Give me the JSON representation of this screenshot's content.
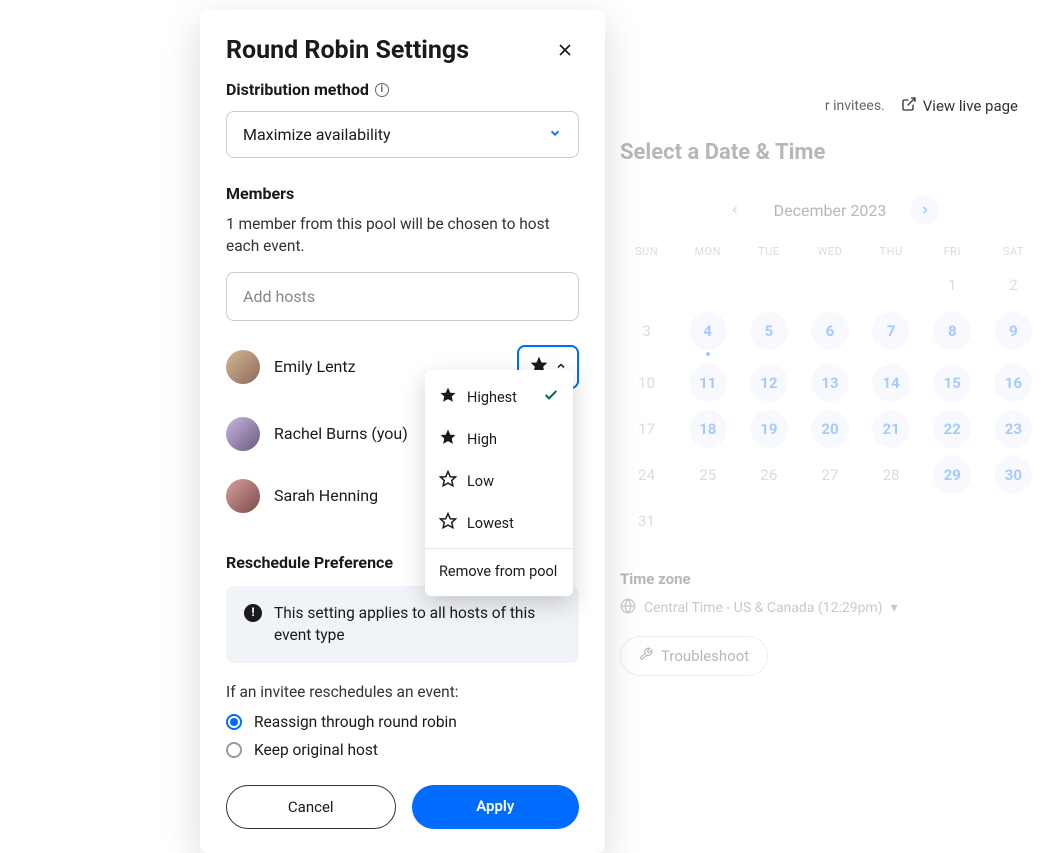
{
  "header": {
    "note_suffix": "r invitees.",
    "view_live": "View live page"
  },
  "modal": {
    "title": "Round Robin Settings",
    "distribution_label": "Distribution method",
    "distribution_value": "Maximize availability",
    "members_title": "Members",
    "members_desc": "1 member from this pool will be chosen to host each event.",
    "add_hosts_placeholder": "Add hosts",
    "members": [
      {
        "name": "Emily Lentz"
      },
      {
        "name": "Rachel Burns (you)"
      },
      {
        "name": "Sarah Henning"
      }
    ],
    "reschedule_title": "Reschedule Preference",
    "notice": "This setting applies to all hosts of this event type",
    "reschedule_prompt": "If an invitee reschedules an event:",
    "radio_reassign": "Reassign through round robin",
    "radio_keep": "Keep original host",
    "cancel": "Cancel",
    "apply": "Apply"
  },
  "priority_menu": {
    "items": [
      {
        "label": "Highest",
        "fill": "full",
        "selected": true
      },
      {
        "label": "High",
        "fill": "full",
        "selected": false
      },
      {
        "label": "Low",
        "fill": "outline",
        "selected": false
      },
      {
        "label": "Lowest",
        "fill": "outline",
        "selected": false
      }
    ],
    "remove": "Remove from pool"
  },
  "calendar": {
    "title": "Select a Date & Time",
    "month": "December 2023",
    "dow": [
      "SUN",
      "MON",
      "TUE",
      "WED",
      "THU",
      "FRI",
      "SAT"
    ],
    "weeks": [
      [
        {
          "d": ""
        },
        {
          "d": ""
        },
        {
          "d": ""
        },
        {
          "d": ""
        },
        {
          "d": ""
        },
        {
          "d": "1"
        },
        {
          "d": "2"
        }
      ],
      [
        {
          "d": "3"
        },
        {
          "d": "4",
          "a": true,
          "today": true
        },
        {
          "d": "5",
          "a": true
        },
        {
          "d": "6",
          "a": true
        },
        {
          "d": "7",
          "a": true
        },
        {
          "d": "8",
          "a": true
        },
        {
          "d": "9",
          "a": true
        }
      ],
      [
        {
          "d": "10"
        },
        {
          "d": "11",
          "a": true
        },
        {
          "d": "12",
          "a": true
        },
        {
          "d": "13",
          "a": true
        },
        {
          "d": "14",
          "a": true
        },
        {
          "d": "15",
          "a": true
        },
        {
          "d": "16",
          "a": true
        }
      ],
      [
        {
          "d": "17"
        },
        {
          "d": "18",
          "a": true
        },
        {
          "d": "19",
          "a": true
        },
        {
          "d": "20",
          "a": true
        },
        {
          "d": "21",
          "a": true
        },
        {
          "d": "22",
          "a": true
        },
        {
          "d": "23",
          "a": true
        }
      ],
      [
        {
          "d": "24"
        },
        {
          "d": "25"
        },
        {
          "d": "26"
        },
        {
          "d": "27"
        },
        {
          "d": "28"
        },
        {
          "d": "29",
          "a": true
        },
        {
          "d": "30",
          "a": true
        }
      ],
      [
        {
          "d": "31"
        },
        {
          "d": ""
        },
        {
          "d": ""
        },
        {
          "d": ""
        },
        {
          "d": ""
        },
        {
          "d": ""
        },
        {
          "d": ""
        }
      ]
    ],
    "tz_title": "Time zone",
    "tz_value": "Central Time - US & Canada (12:29pm)",
    "troubleshoot": "Troubleshoot"
  }
}
